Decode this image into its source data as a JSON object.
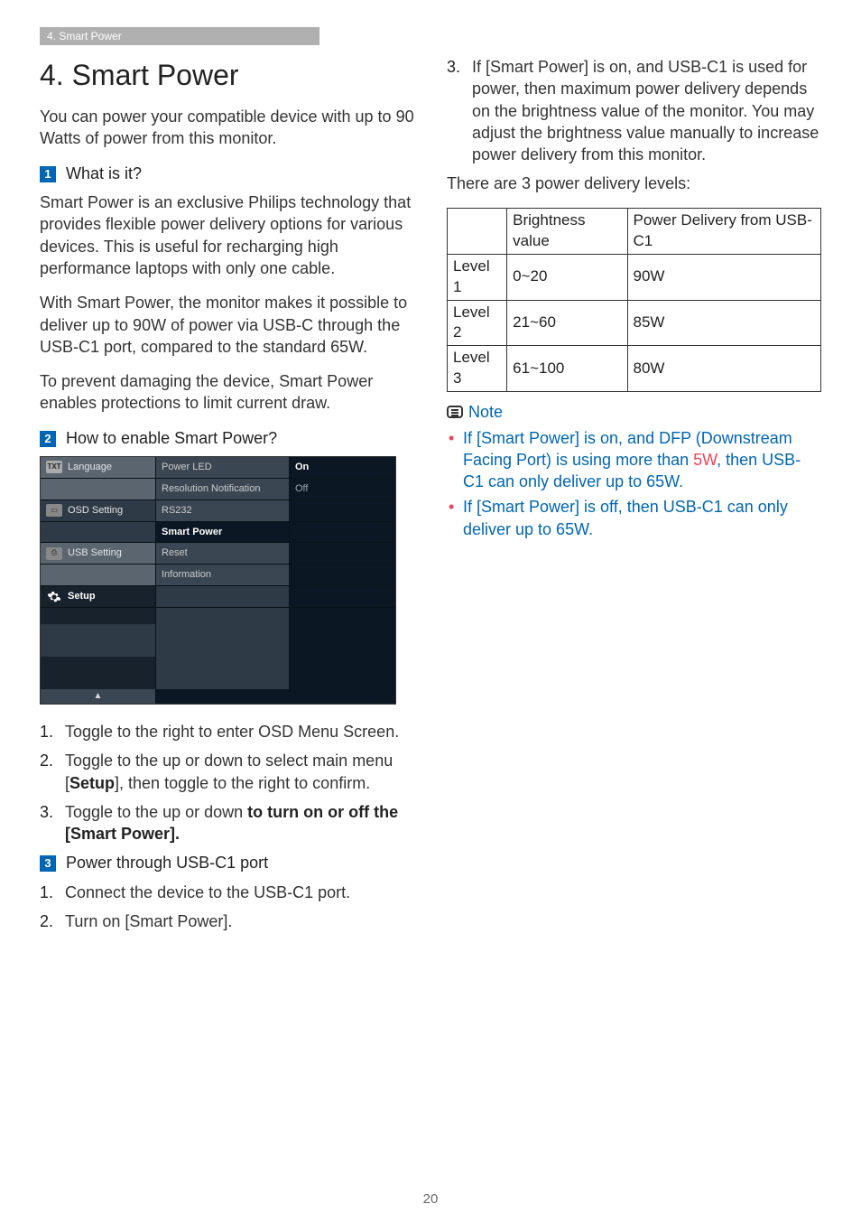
{
  "header_tab": "4. Smart Power",
  "h1": "4.  Smart Power",
  "intro": "You can power your compatible device with up to 90 Watts of power from this monitor.",
  "s1": {
    "num": "1",
    "title": "What is it?",
    "p1": "Smart Power is an exclusive Philips technology that provides flexible power delivery options for various devices. This is useful for recharging high performance laptops with only one cable.",
    "p2": "With Smart Power, the monitor makes it possible to deliver up to 90W of power via USB-C through the USB-C1 port, compared to the standard 65W.",
    "p3": "To prevent damaging the device, Smart Power enables protections to limit current draw."
  },
  "s2": {
    "num": "2",
    "title": "How to enable Smart Power?",
    "osd": {
      "menu": [
        {
          "label": "Language",
          "icon": "TXT"
        },
        {
          "label": "OSD Setting",
          "icon": "osd"
        },
        {
          "label": "USB Setting",
          "icon": "usb"
        },
        {
          "label": "Setup",
          "icon": "gear",
          "active": true
        }
      ],
      "items": [
        {
          "label": "Power LED",
          "value": "On",
          "value_on": true
        },
        {
          "label": "Resolution Notification",
          "value": "Off"
        },
        {
          "label": "RS232",
          "value": ""
        },
        {
          "label": "Smart Power",
          "value": "",
          "highlight": true
        },
        {
          "label": "Reset",
          "value": ""
        },
        {
          "label": "Information",
          "value": ""
        }
      ],
      "arrow": "▲"
    },
    "steps": [
      "Toggle to the right to enter OSD Menu Screen.",
      "Toggle to the up or down to select main menu [Setup], then toggle to the right to confirm.",
      "Toggle to the up or down to turn on or off the [Smart Power]."
    ],
    "step2_bold": "Setup",
    "step3_tail_bold": "to turn on or off the",
    "step3_tail_rest": " [Smart Power]."
  },
  "s3": {
    "num": "3",
    "title": "Power through USB-C1 port",
    "steps": [
      "Connect the device to the USB-C1 port.",
      "Turn on [Smart Power].",
      "If [Smart Power] is on, and USB-C1 is used for power, then maximum power delivery depends on the brightness value of the monitor. You may adjust the brightness value manually to increase power delivery from this monitor."
    ]
  },
  "pd_intro": "There are 3 power delivery levels:",
  "pd_table": {
    "head": [
      "",
      "Brightness value",
      "Power Delivery from USB-C1"
    ],
    "rows": [
      [
        "Level 1",
        "0~20",
        "90W"
      ],
      [
        "Level 2",
        "21~60",
        "85W"
      ],
      [
        "Level 3",
        "61~100",
        "80W"
      ]
    ]
  },
  "note": {
    "label": "Note",
    "items": [
      {
        "pre": "If [Smart Power] is on, and DFP (Downstream Facing Port) is using more than ",
        "red": "5W",
        "post": ", then USB-C1 can only deliver up to 65W."
      },
      {
        "pre": "If [Smart Power] is off, then USB-C1 can only deliver up to 65W.",
        "red": "",
        "post": ""
      }
    ]
  },
  "page_number": "20"
}
